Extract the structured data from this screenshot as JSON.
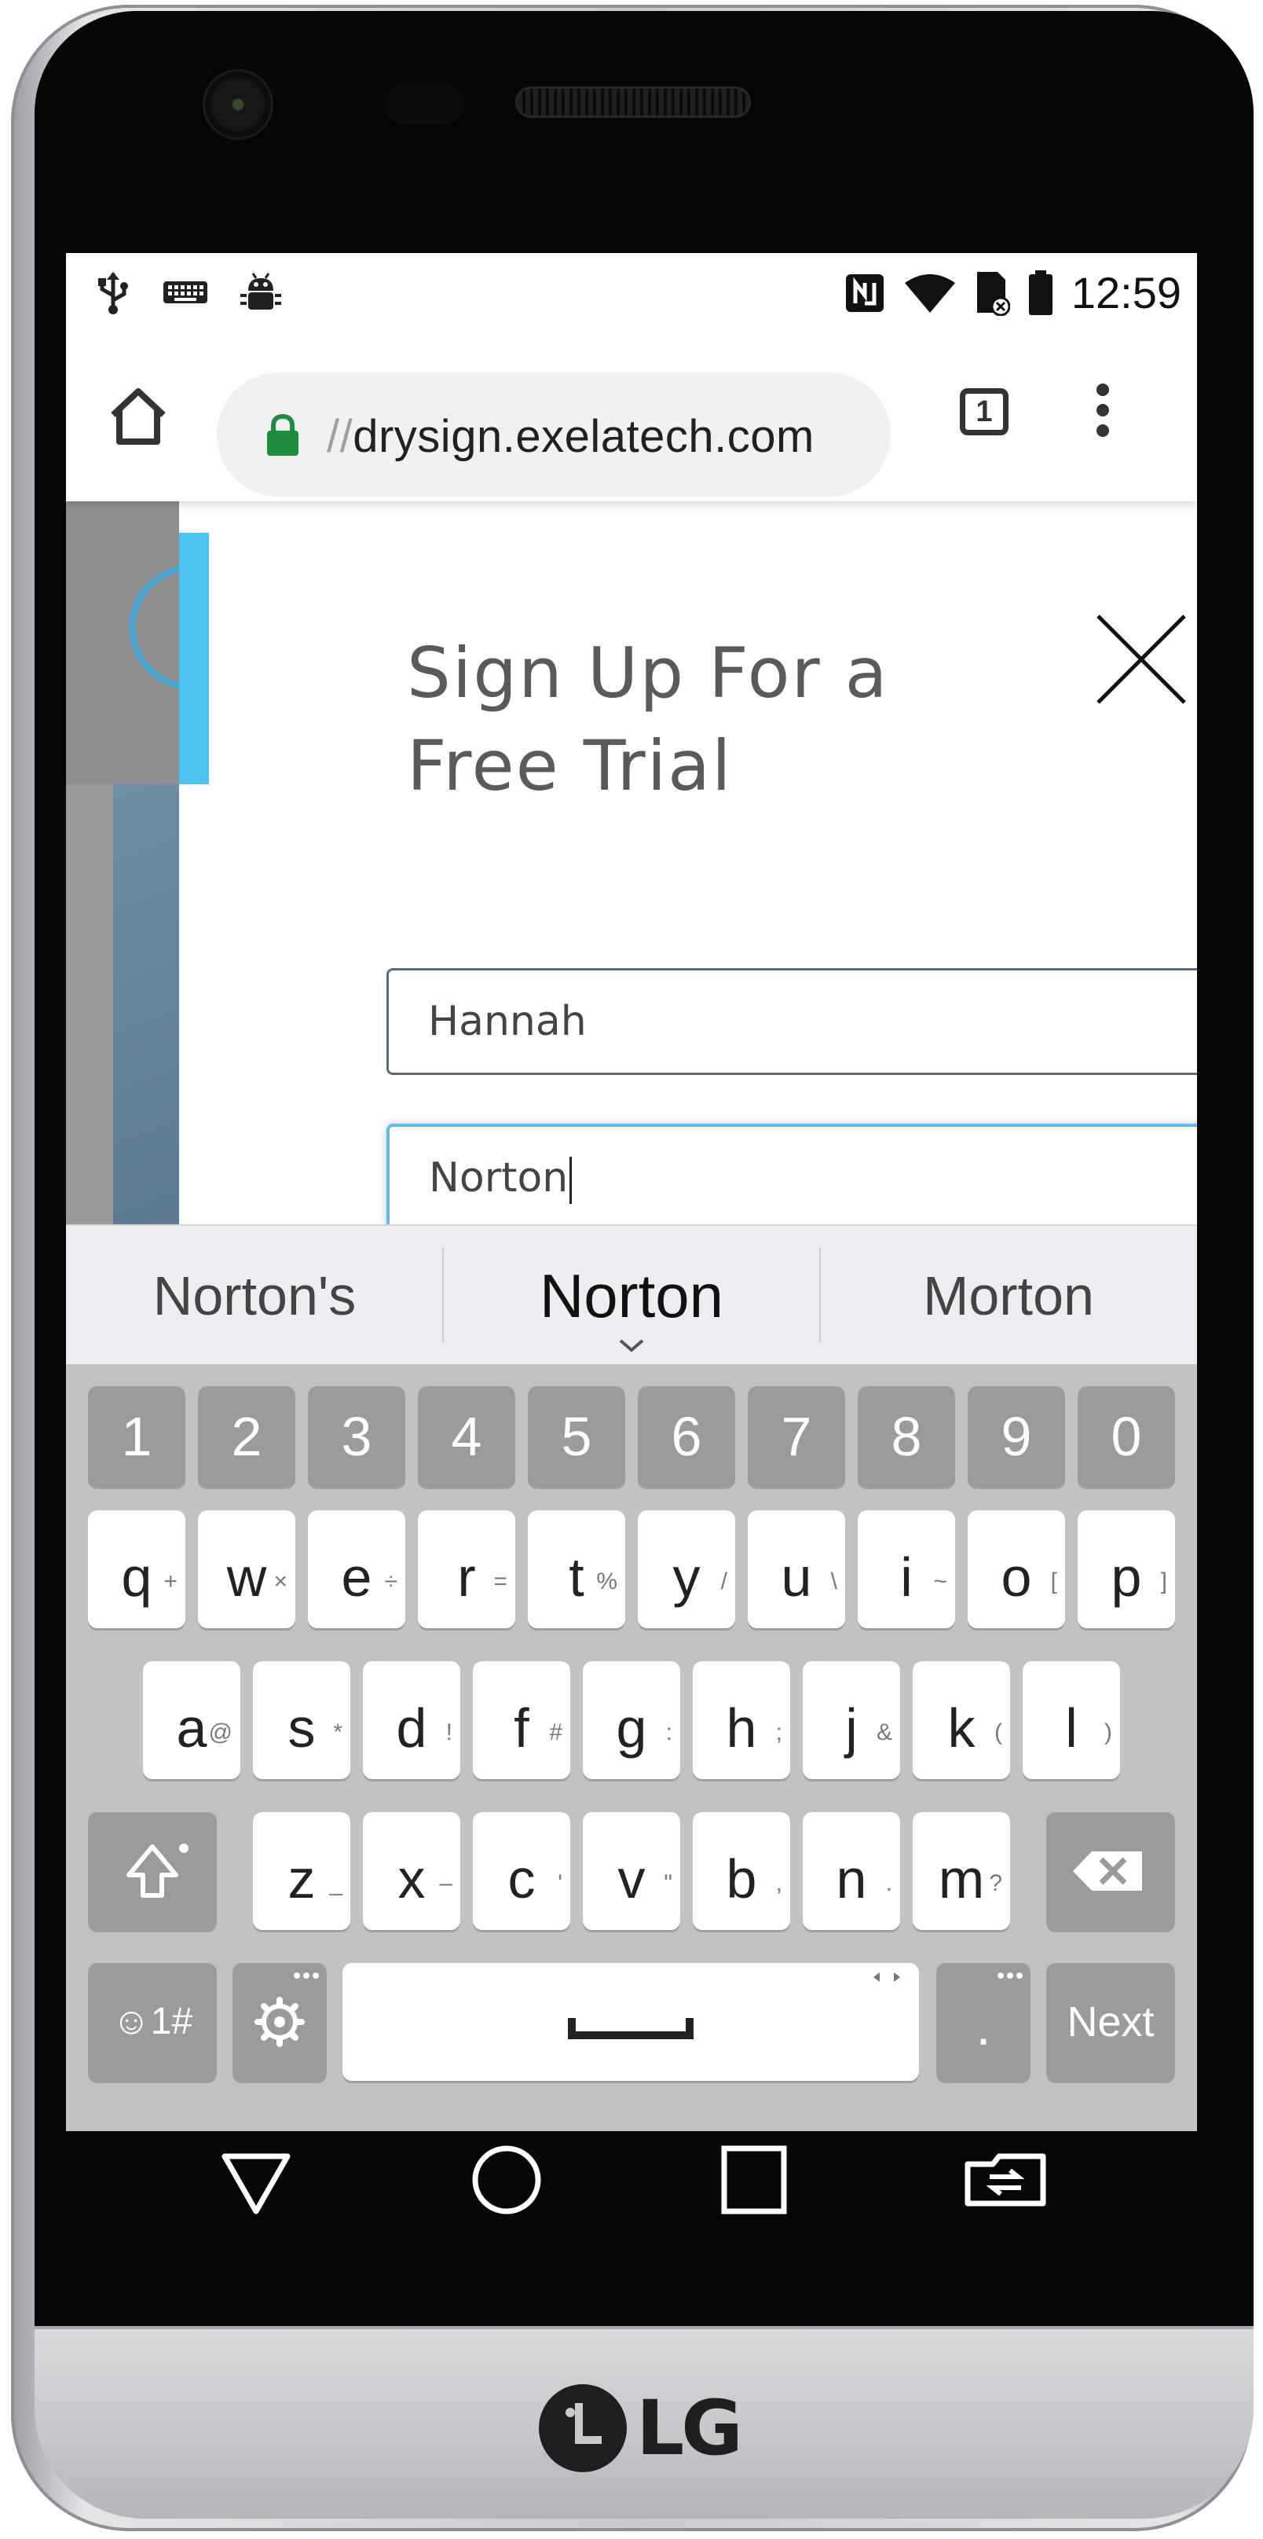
{
  "status_bar": {
    "time": "12:59",
    "left_icons": [
      "usb-icon",
      "keyboard-icon",
      "android-debug-icon"
    ],
    "right_icons": [
      "nfc-icon",
      "wifi-icon",
      "sim-no-icon",
      "battery-icon"
    ]
  },
  "browser": {
    "url_prefix": "//",
    "url": "drysign.exelatech.com",
    "tab_count": "1"
  },
  "modal": {
    "title_line1": "Sign Up For a",
    "title_line2": "Free Trial",
    "first_name_value": "Hannah",
    "last_name_value": "Norton"
  },
  "suggestions": [
    "Norton's",
    "Norton",
    "Morton"
  ],
  "keyboard": {
    "number_row": [
      "1",
      "2",
      "3",
      "4",
      "5",
      "6",
      "7",
      "8",
      "9",
      "0"
    ],
    "row1": [
      {
        "key": "q",
        "alt": "+"
      },
      {
        "key": "w",
        "alt": "×"
      },
      {
        "key": "e",
        "alt": "÷"
      },
      {
        "key": "r",
        "alt": "="
      },
      {
        "key": "t",
        "alt": "%"
      },
      {
        "key": "y",
        "alt": "/"
      },
      {
        "key": "u",
        "alt": "\\"
      },
      {
        "key": "i",
        "alt": "~"
      },
      {
        "key": "o",
        "alt": "["
      },
      {
        "key": "p",
        "alt": "]"
      }
    ],
    "row2": [
      {
        "key": "a",
        "alt": "@"
      },
      {
        "key": "s",
        "alt": "*"
      },
      {
        "key": "d",
        "alt": "!"
      },
      {
        "key": "f",
        "alt": "#"
      },
      {
        "key": "g",
        "alt": ":"
      },
      {
        "key": "h",
        "alt": ";"
      },
      {
        "key": "j",
        "alt": "&"
      },
      {
        "key": "k",
        "alt": "("
      },
      {
        "key": "l",
        "alt": ")"
      }
    ],
    "row3": [
      {
        "key": "z",
        "alt": "_"
      },
      {
        "key": "x",
        "alt": "–"
      },
      {
        "key": "c",
        "alt": "'"
      },
      {
        "key": "v",
        "alt": "\""
      },
      {
        "key": "b",
        "alt": ","
      },
      {
        "key": "n",
        "alt": "."
      },
      {
        "key": "m",
        "alt": "?"
      }
    ],
    "symbols_label": "☺1#",
    "period_label": ".",
    "next_label": "Next"
  },
  "device": {
    "brand": "LG"
  }
}
